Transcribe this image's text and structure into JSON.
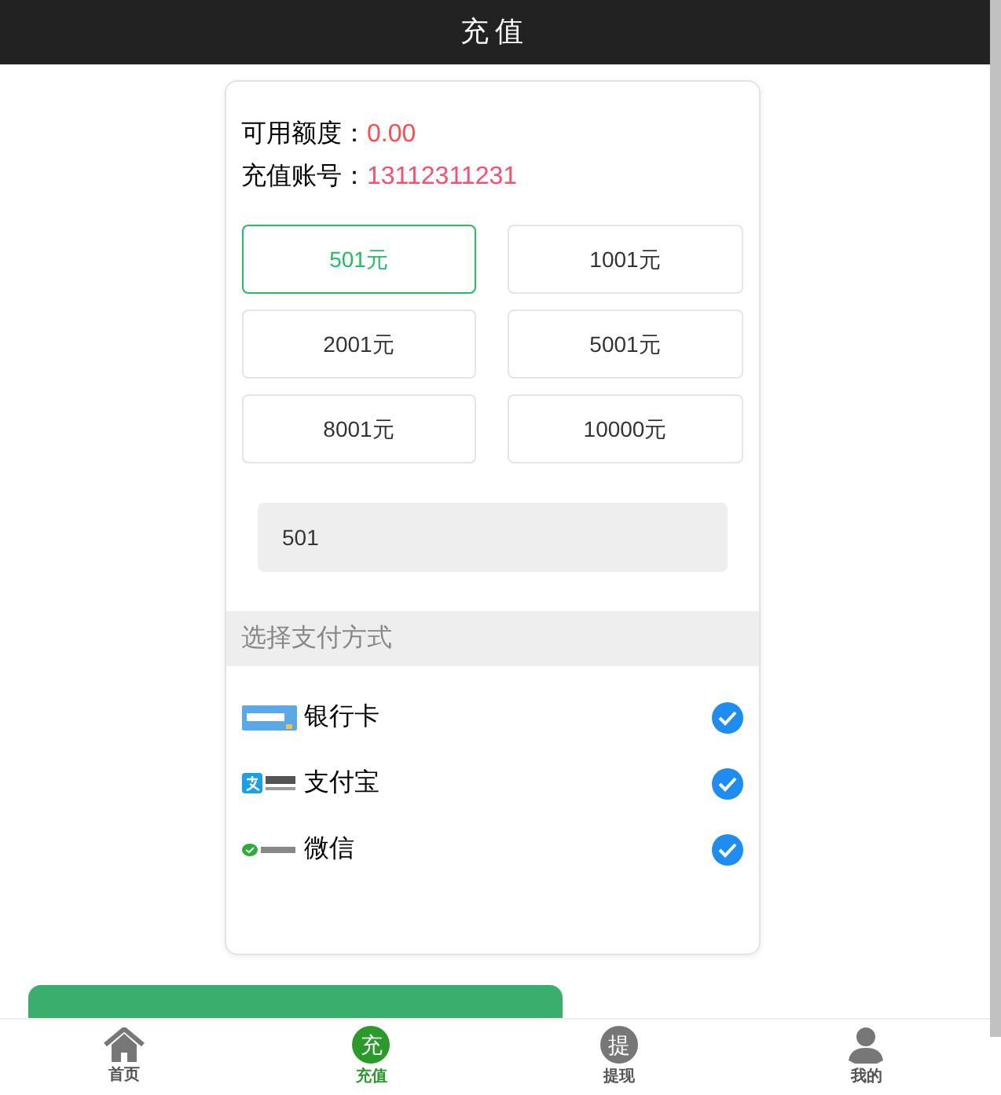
{
  "header": {
    "title": "充值"
  },
  "balance": {
    "label": "可用额度：",
    "value": "0.00"
  },
  "account": {
    "label": "充值账号：",
    "value": "13112311231"
  },
  "amounts": [
    {
      "label": "501元",
      "selected": true
    },
    {
      "label": "1001元",
      "selected": false
    },
    {
      "label": "2001元",
      "selected": false
    },
    {
      "label": "5001元",
      "selected": false
    },
    {
      "label": "8001元",
      "selected": false
    },
    {
      "label": "10000元",
      "selected": false
    }
  ],
  "amount_field": {
    "value": "501"
  },
  "payment_section": {
    "title": "选择支付方式"
  },
  "payment_methods": [
    {
      "kind": "bank",
      "label": "银行卡",
      "checked": true
    },
    {
      "kind": "alipay",
      "label": "支付宝",
      "checked": true
    },
    {
      "kind": "wechat",
      "label": "微信",
      "checked": true
    }
  ],
  "tab_bar": [
    {
      "kind": "home",
      "label": "首页",
      "selected": false
    },
    {
      "kind": "charge",
      "label": "充值",
      "icon_text": "充",
      "selected": true
    },
    {
      "kind": "withdraw",
      "label": "提现",
      "icon_text": "提",
      "selected": false
    },
    {
      "kind": "user",
      "label": "我的",
      "selected": false
    }
  ]
}
